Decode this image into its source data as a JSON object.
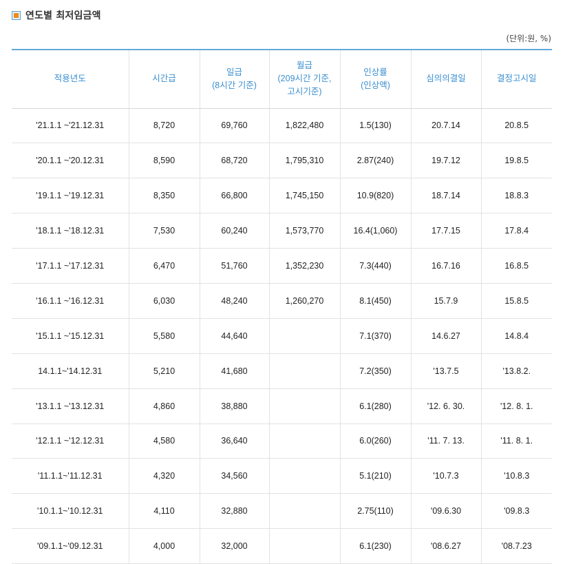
{
  "title": "연도별 최저임금액",
  "unit_note": "(단위:원, %)",
  "columns": [
    {
      "lines": [
        "적용년도"
      ]
    },
    {
      "lines": [
        "시간급"
      ]
    },
    {
      "lines": [
        "일급",
        "(8시간 기준)"
      ]
    },
    {
      "lines": [
        "월급",
        "(209시간 기준,",
        "고시기준)"
      ]
    },
    {
      "lines": [
        "인상률",
        "(인상액)"
      ]
    },
    {
      "lines": [
        "심의의결일"
      ]
    },
    {
      "lines": [
        "결정고시일"
      ]
    }
  ],
  "rows": [
    [
      "'21.1.1 ~'21.12.31",
      "8,720",
      "69,760",
      "1,822,480",
      "1.5(130)",
      "20.7.14",
      "20.8.5"
    ],
    [
      "'20.1.1 ~'20.12.31",
      "8,590",
      "68,720",
      "1,795,310",
      "2.87(240)",
      "19.7.12",
      "19.8.5"
    ],
    [
      "'19.1.1 ~'19.12.31",
      "8,350",
      "66,800",
      "1,745,150",
      "10.9(820)",
      "18.7.14",
      "18.8.3"
    ],
    [
      "'18.1.1 ~'18.12.31",
      "7,530",
      "60,240",
      "1,573,770",
      "16.4(1,060)",
      "17.7.15",
      "17.8.4"
    ],
    [
      "'17.1.1 ~'17.12.31",
      "6,470",
      "51,760",
      "1,352,230",
      "7.3(440)",
      "16.7.16",
      "16.8.5"
    ],
    [
      "'16.1.1 ~'16.12.31",
      "6,030",
      "48,240",
      "1,260,270",
      "8.1(450)",
      "15.7.9",
      "15.8.5"
    ],
    [
      "'15.1.1 ~'15.12.31",
      "5,580",
      "44,640",
      "",
      "7.1(370)",
      "14.6.27",
      "14.8.4"
    ],
    [
      "14.1.1~'14.12.31",
      "5,210",
      "41,680",
      "",
      "7.2(350)",
      "'13.7.5",
      "'13.8.2."
    ],
    [
      "'13.1.1 ~'13.12.31",
      "4,860",
      "38,880",
      "",
      "6.1(280)",
      "'12. 6. 30.",
      "'12. 8. 1."
    ],
    [
      "'12.1.1 ~'12.12.31",
      "4,580",
      "36,640",
      "",
      "6.0(260)",
      "'11. 7. 13.",
      "'11. 8. 1."
    ],
    [
      "'11.1.1~'11.12.31",
      "4,320",
      "34,560",
      "",
      "5.1(210)",
      "'10.7.3",
      "'10.8.3"
    ],
    [
      "'10.1.1~'10.12.31",
      "4,110",
      "32,880",
      "",
      "2.75(110)",
      "'09.6.30",
      "'09.8.3"
    ],
    [
      "'09.1.1~'09.12.31",
      "4,000",
      "32,000",
      "",
      "6.1(230)",
      "'08.6.27",
      "'08.7.23"
    ]
  ]
}
